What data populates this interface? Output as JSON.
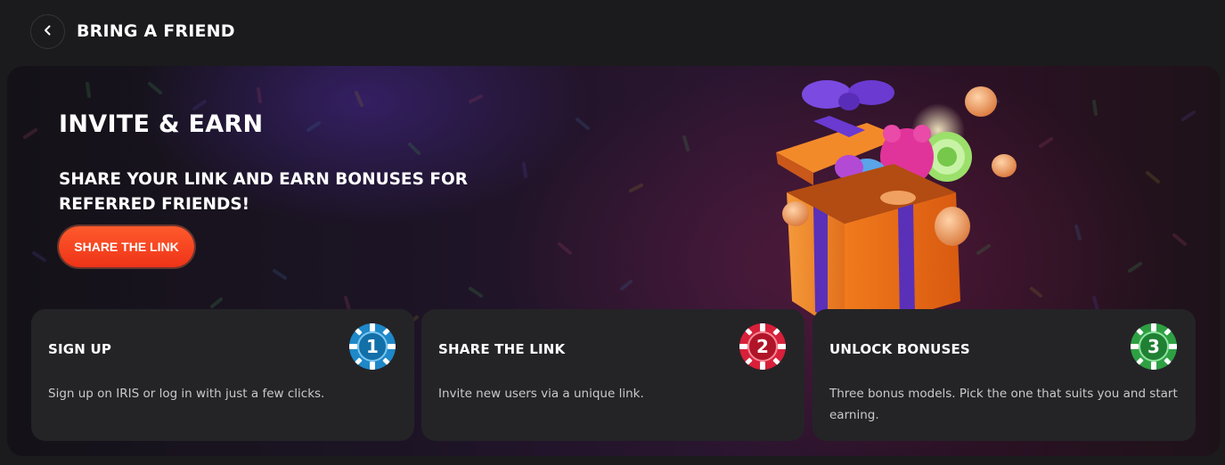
{
  "header": {
    "back_icon": "chevron-left-icon",
    "title": "BRING A FRIEND"
  },
  "hero": {
    "title": "INVITE & EARN",
    "subtitle": "SHARE YOUR LINK AND EARN BONUSES FOR REFERRED FRIENDS!",
    "share_button_label": "SHARE THE LINK",
    "illustration": "gift-box-with-candy-and-coins"
  },
  "steps": [
    {
      "title": "SIGN UP",
      "description": "Sign up on IRIS or log in with just a few clicks.",
      "chip_number": "1",
      "chip_color": "#1e88c8"
    },
    {
      "title": "SHARE THE LINK",
      "description": "Invite new users via a unique link.",
      "chip_number": "2",
      "chip_color": "#d8203a"
    },
    {
      "title": "UNLOCK BONUSES",
      "description": "Three bonus models. Pick the one that suits you and start earning.",
      "chip_number": "3",
      "chip_color": "#2ea043"
    }
  ],
  "colors": {
    "background": "#1b1b1d",
    "card": "#242427",
    "accent": "#f2421f"
  }
}
